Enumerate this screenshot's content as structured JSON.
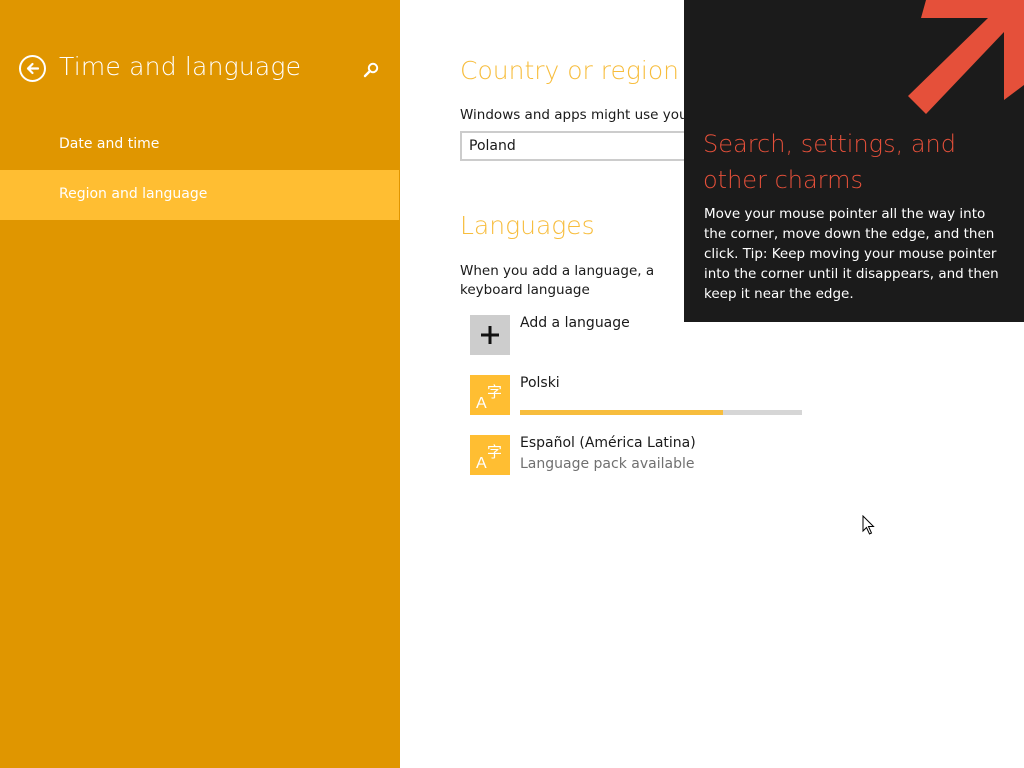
{
  "sidebar": {
    "title": "Time and language",
    "items": [
      {
        "label": "Date and time",
        "selected": false
      },
      {
        "label": "Region and language",
        "selected": true
      }
    ]
  },
  "main": {
    "country": {
      "title": "Country or region",
      "description": "Windows and apps might use your",
      "selected_value": "Poland"
    },
    "languages": {
      "title": "Languages",
      "description": "When you add a language, a keyboard language",
      "add_label": "Add a language",
      "items": [
        {
          "name": "Polski",
          "progress": 0.72,
          "status": ""
        },
        {
          "name": "Español (América Latina)",
          "status": "Language pack available"
        }
      ]
    }
  },
  "charms_tip": {
    "title": "Search, settings, and other charms",
    "body": "Move your mouse pointer all the way into the corner, move down the edge, and then click. Tip: Keep moving your mouse pointer into the corner until it disappears, and then keep it near the edge."
  },
  "colors": {
    "sidebar_bg": "#e09600",
    "selected_item_bg": "#ffbe32",
    "accent_text": "#f7bd3d",
    "tip_bg": "#1b1b1b",
    "tip_accent": "#e5503a"
  },
  "icons": {
    "back": "back-arrow-icon",
    "search": "search-icon",
    "add": "plus-icon",
    "language": "language-tile-icon",
    "arrow": "charms-arrow-icon",
    "cursor": "mouse-cursor-icon"
  }
}
